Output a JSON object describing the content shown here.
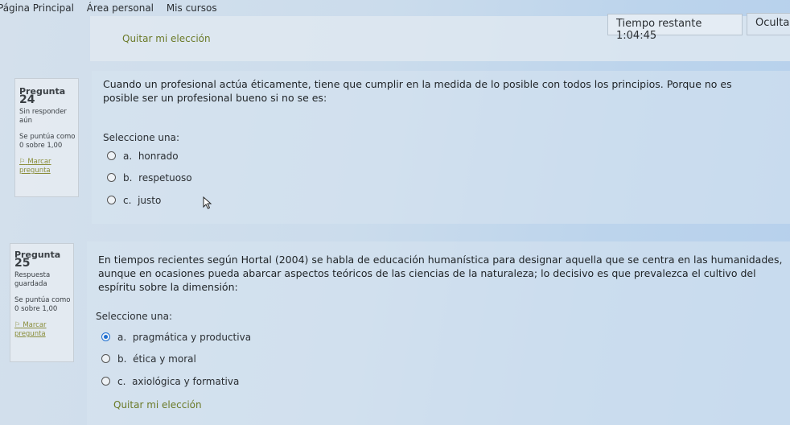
{
  "nav": {
    "items": [
      "Página Principal",
      "Área personal",
      "Mis cursos"
    ]
  },
  "header": {
    "clear_choice": "Quitar mi elección",
    "timer_label": "Tiempo restante",
    "timer_value": "1:04:45",
    "hide_button": "Ocultar"
  },
  "questions": [
    {
      "label": "Pregunta",
      "number": "24",
      "state": "Sin responder aún",
      "grade": "Se puntúa como 0 sobre 1,00",
      "flag": "Marcar pregunta",
      "text": "Cuando un profesional actúa éticamente, tiene que cumplir en la medida de lo posible con todos los principios. Porque no es posible ser un profesional bueno si no se es:",
      "prompt": "Seleccione una:",
      "options": [
        {
          "letter": "a.",
          "label": "honrado",
          "selected": false
        },
        {
          "letter": "b.",
          "label": "respetuoso",
          "selected": false
        },
        {
          "letter": "c.",
          "label": "justo",
          "selected": false
        }
      ]
    },
    {
      "label": "Pregunta",
      "number": "25",
      "state": "Respuesta guardada",
      "grade": "Se puntúa como 0 sobre 1,00",
      "flag": "Marcar pregunta",
      "text": "En tiempos recientes según Hortal (2004) se habla de educación humanística para designar aquella que se centra en las humanidades, aunque en ocasiones pueda abarcar aspectos teóricos de las ciencias de la naturaleza; lo decisivo es que prevalezca el cultivo del espíritu sobre la dimensión:",
      "prompt": "Seleccione una:",
      "options": [
        {
          "letter": "a.",
          "label": "pragmática y productiva",
          "selected": true
        },
        {
          "letter": "b.",
          "label": "ética y moral",
          "selected": false
        },
        {
          "letter": "c.",
          "label": "axiológica y formativa",
          "selected": false
        }
      ],
      "clear_choice": "Quitar mi elección"
    }
  ],
  "colors": {
    "selected_radio": "#1f6fd1",
    "link_olive": "#6b7a28"
  }
}
